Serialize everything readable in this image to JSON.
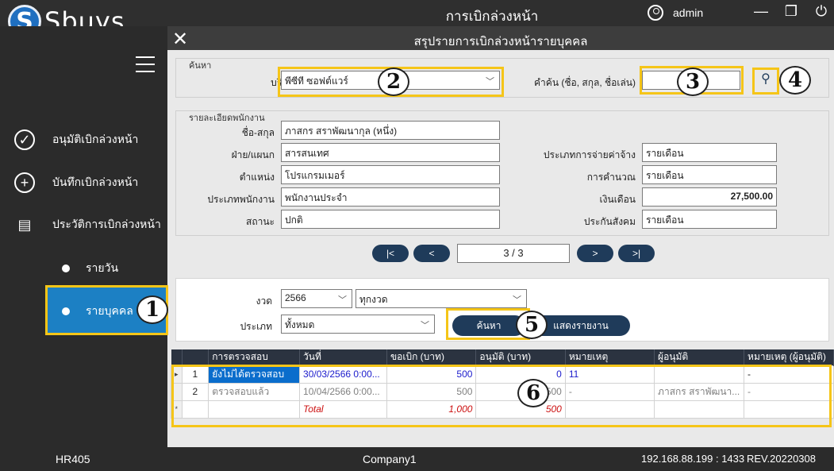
{
  "app": {
    "logo_letter": "S",
    "logo_text": "Sbuys",
    "title": "การเบิกล่วงหน้า",
    "user": "admin"
  },
  "window": {
    "minimize": "—",
    "maximize": "❐",
    "power": "⏻"
  },
  "sidebar": {
    "items": [
      {
        "label": "อนุมัติเบิกล่วงหน้า",
        "icon": "check-circle-icon"
      },
      {
        "label": "บันทึกเบิกล่วงหน้า",
        "icon": "plus-circle-icon"
      },
      {
        "label": "ประวัติการเบิกล่วงหน้า",
        "icon": "history-document-icon"
      }
    ],
    "sub_items": [
      {
        "label": "รายวัน"
      },
      {
        "label": "รายบุคคล"
      }
    ]
  },
  "dialog": {
    "title": "สรุปรายการเบิกล่วงหน้ารายบุคคล",
    "close": "✕"
  },
  "search": {
    "group_title": "ค้นหา",
    "company_label": "บริษัท",
    "company_value": "พีซีที ซอฟต์แวร์",
    "keyword_label": "คำค้น (ชื่อ, สกุล, ชื่อเล่น)",
    "keyword_value": ""
  },
  "employee": {
    "group_title": "รายละเอียดพนักงาน",
    "name_label": "ชื่อ-สกุล",
    "name_value": "ภาสกร สราพัฒนากุล (หนึ่ง)",
    "dept_label": "ฝ่าย/แผนก",
    "dept_value": "สารสนเทศ",
    "position_label": "ตำแหน่ง",
    "position_value": "โปรแกรมเมอร์",
    "type_label": "ประเภทพนักงาน",
    "type_value": "พนักงานประจำ",
    "status_label": "สถานะ",
    "status_value": "ปกติ",
    "paytype_label": "ประเภทการจ่ายค่าจ้าง",
    "paytype_value": "รายเดือน",
    "calc_label": "การคำนวณ",
    "calc_value": "รายเดือน",
    "salary_label": "เงินเดือน",
    "salary_value": "27,500.00",
    "ss_label": "ประกันสังคม",
    "ss_value": "รายเดือน"
  },
  "pager": {
    "first": "|<",
    "prev": "<",
    "indicator": "3 / 3",
    "next": ">",
    "last": ">|"
  },
  "filter": {
    "period_label": "งวด",
    "year_value": "2566",
    "period_value": "ทุกงวด",
    "type_label": "ประเภท",
    "type_value": "ทั้งหมด",
    "search_button": "ค้นหา",
    "report_button": "แสดงรายงาน"
  },
  "grid": {
    "columns": [
      "การตรวจสอบ",
      "วันที่",
      "ขอเบิก (บาท)",
      "อนุมัติ (บาท)",
      "หมายเหตุ",
      "ผู้อนุมัติ",
      "หมายเหตุ (ผู้อนุมัติ)"
    ],
    "rows": [
      {
        "no": "1",
        "check": "ยังไม่ได้ตรวจสอบ",
        "date": "30/03/2566 0:00...",
        "request": "500",
        "approve": "0",
        "note": "11",
        "approver": "",
        "approver_note": "-"
      },
      {
        "no": "2",
        "check": "ตรวจสอบแล้ว",
        "date": "10/04/2566 0:00...",
        "request": "500",
        "approve": "500",
        "note": "-",
        "approver": "ภาสกร สราพัฒนา...",
        "approver_note": "-"
      }
    ],
    "total": {
      "label": "Total",
      "request": "1,000",
      "approve": "500"
    },
    "new_row_marker": "*",
    "current_row_marker": "▸"
  },
  "status": {
    "code": "HR405",
    "company": "Company1",
    "server": "192.168.88.199 : 1433",
    "rev": "REV.20220308"
  },
  "callouts": [
    "1",
    "2",
    "3",
    "4",
    "5",
    "6"
  ],
  "colors": {
    "accent": "#1c80c4",
    "dark_button": "#1f3b5a",
    "highlight": "#f5c518"
  }
}
